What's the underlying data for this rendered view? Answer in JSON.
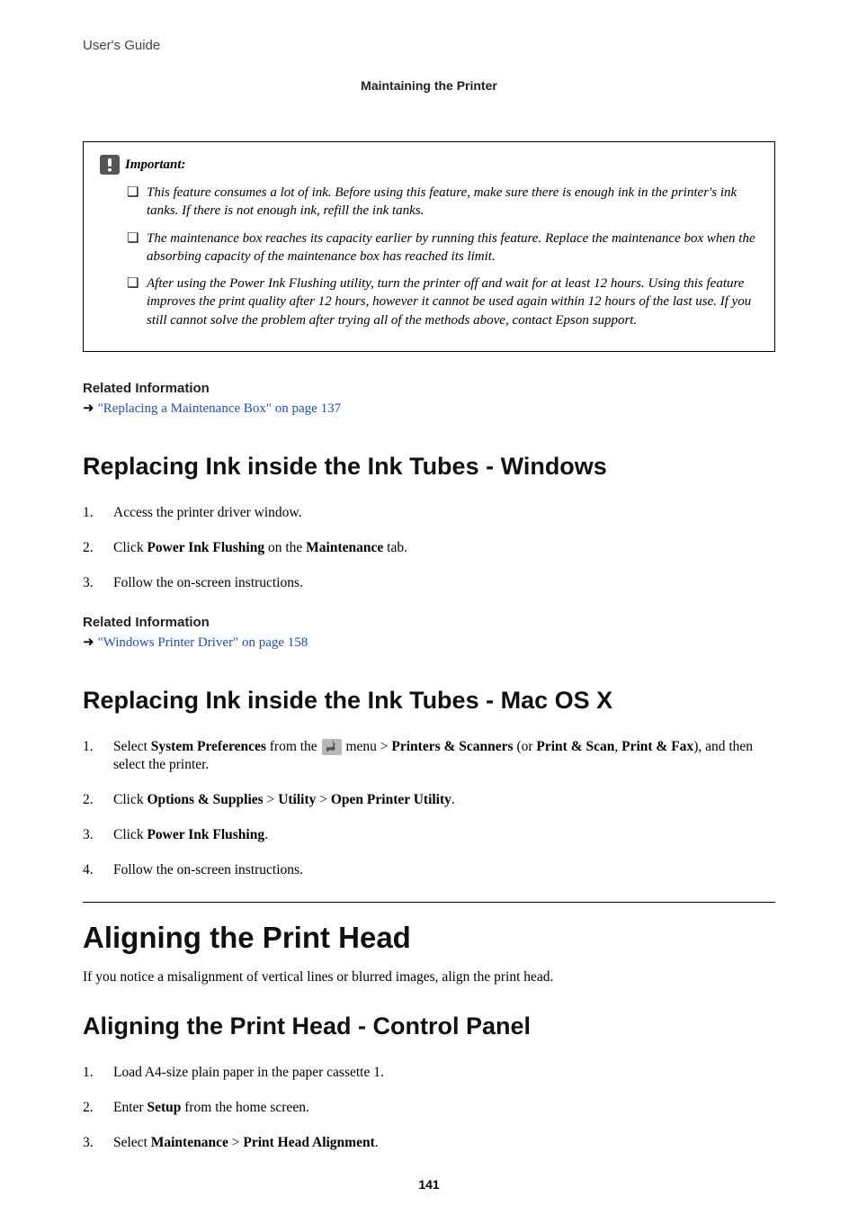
{
  "header": {
    "guide": "User's Guide"
  },
  "breadcrumb": "Maintaining the Printer",
  "important": {
    "label": "Important:",
    "items": [
      "This feature consumes a lot of ink. Before using this feature, make sure there is enough ink in the printer's ink tanks. If there is not enough ink, refill the ink tanks.",
      "The maintenance box reaches its capacity earlier by running this feature. Replace the maintenance box when the absorbing capacity of the maintenance box has reached its limit.",
      "After using the Power Ink Flushing utility, turn the printer off and wait for at least 12 hours. Using this feature improves the print quality after 12 hours, however it cannot be used again within 12 hours of the last use. If you still cannot solve the problem after trying all of the methods above, contact Epson support."
    ]
  },
  "related1": {
    "heading": "Related Information",
    "link": "\"Replacing a Maintenance Box\" on page 137"
  },
  "section_win": {
    "title": "Replacing Ink inside the Ink Tubes - Windows",
    "step1": "Access the printer driver window.",
    "step2_a": "Click ",
    "step2_b": "Power Ink Flushing",
    "step2_c": " on the ",
    "step2_d": "Maintenance",
    "step2_e": " tab.",
    "step3": "Follow the on-screen instructions."
  },
  "related2": {
    "heading": "Related Information",
    "link": "\"Windows Printer Driver\" on page 158"
  },
  "section_mac": {
    "title": "Replacing Ink inside the Ink Tubes - Mac OS X",
    "s1a": "Select ",
    "s1b": "System Preferences",
    "s1c": " from the ",
    "s1d": " menu > ",
    "s1e": "Printers & Scanners",
    "s1f": " (or ",
    "s1g": "Print & Scan",
    "s1h": ", ",
    "s1i": "Print & Fax",
    "s1j": "), and then select the printer.",
    "s2a": "Click ",
    "s2b": "Options & Supplies",
    "s2c": " > ",
    "s2d": "Utility",
    "s2e": " > ",
    "s2f": "Open Printer Utility",
    "s2g": ".",
    "s3a": "Click ",
    "s3b": "Power Ink Flushing",
    "s3c": ".",
    "s4": "Follow the on-screen instructions."
  },
  "topic_align": {
    "title": "Aligning the Print Head",
    "intro": "If you notice a misalignment of vertical lines or blurred images, align the print head."
  },
  "section_cp": {
    "title": "Aligning the Print Head - Control Panel",
    "s1": "Load A4-size plain paper in the paper cassette 1.",
    "s2a": "Enter ",
    "s2b": "Setup",
    "s2c": " from the home screen.",
    "s3a": "Select ",
    "s3b": "Maintenance",
    "s3c": " > ",
    "s3d": "Print Head Alignment",
    "s3e": "."
  },
  "page": "141"
}
